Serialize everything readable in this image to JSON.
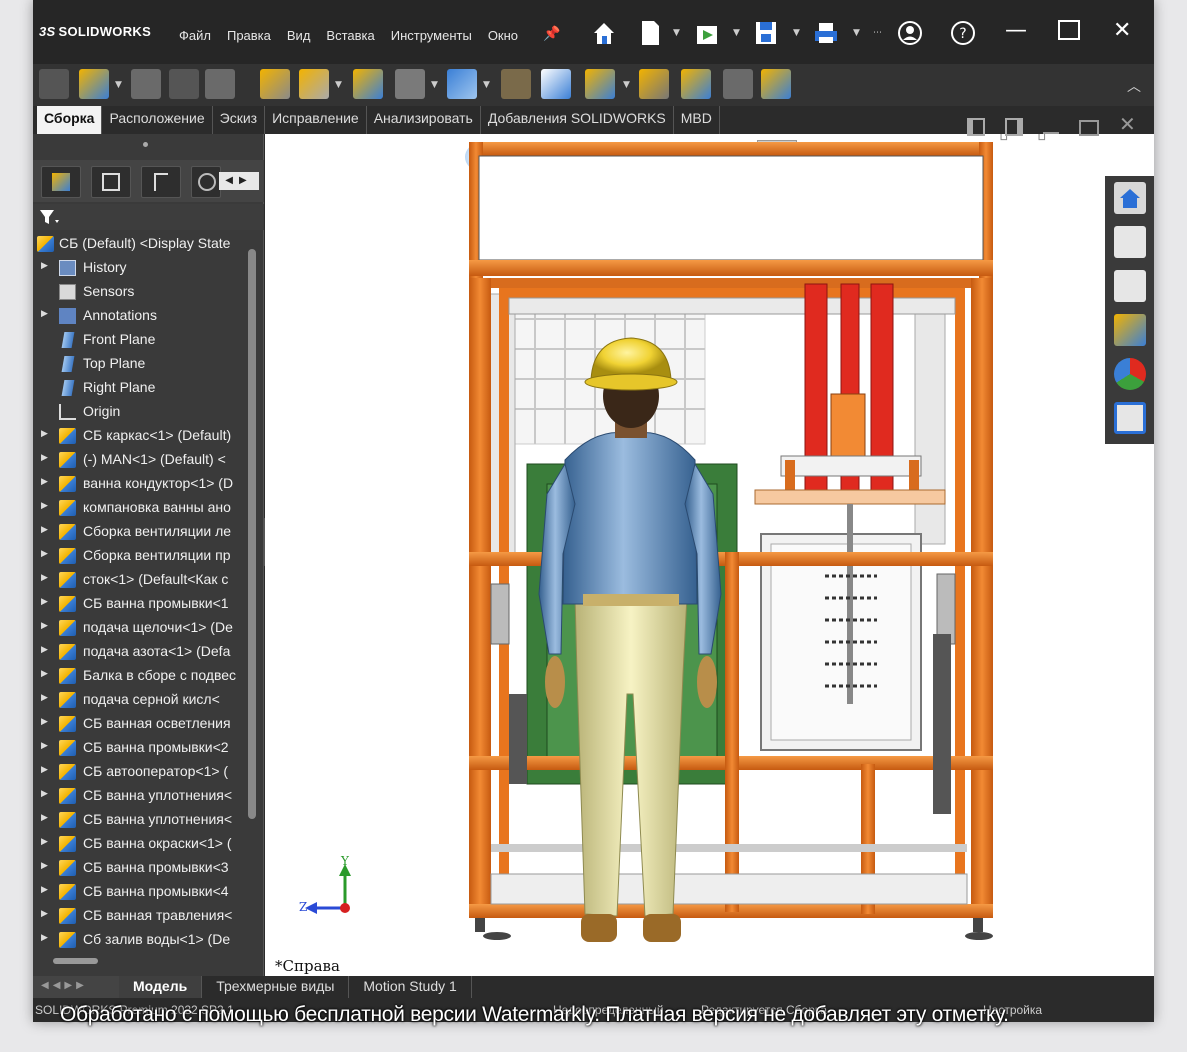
{
  "app": {
    "brand": "SOLIDWORKS",
    "brand_prefix": "3S",
    "menus": [
      "Файл",
      "Правка",
      "Вид",
      "Вставка",
      "Инструменты",
      "Окно"
    ]
  },
  "command_tabs": [
    "Сборка",
    "Расположение",
    "Эскиз",
    "Исправление",
    "Анализировать",
    "Добавления SOLIDWORKS",
    "MBD"
  ],
  "tree": {
    "root": "СБ (Default) <Display State",
    "items": [
      {
        "label": "History",
        "icon": "history",
        "expand": true
      },
      {
        "label": "Sensors",
        "icon": "sensors",
        "expand": false
      },
      {
        "label": "Annotations",
        "icon": "annotations",
        "expand": true
      },
      {
        "label": "Front Plane",
        "icon": "plane",
        "expand": false
      },
      {
        "label": "Top Plane",
        "icon": "plane",
        "expand": false
      },
      {
        "label": "Right Plane",
        "icon": "plane",
        "expand": false
      },
      {
        "label": "Origin",
        "icon": "origin",
        "expand": false
      },
      {
        "label": "СБ каркас<1> (Default)",
        "icon": "assembly",
        "expand": true
      },
      {
        "label": "(-) MAN<1> (Default) <",
        "icon": "assembly",
        "expand": true
      },
      {
        "label": "ванна кондуктор<1> (D",
        "icon": "assembly",
        "expand": true
      },
      {
        "label": "компановка ванны ано",
        "icon": "assembly",
        "expand": true
      },
      {
        "label": "Сборка вентиляции ле",
        "icon": "assembly",
        "expand": true
      },
      {
        "label": "Сборка вентиляции пр",
        "icon": "assembly",
        "expand": true
      },
      {
        "label": "сток<1> (Default<Как с",
        "icon": "assembly",
        "expand": true
      },
      {
        "label": "СБ ванна промывки<1",
        "icon": "assembly",
        "expand": true
      },
      {
        "label": "подача щелочи<1> (De",
        "icon": "assembly",
        "expand": true
      },
      {
        "label": "подача азота<1> (Defa",
        "icon": "assembly",
        "expand": true
      },
      {
        "label": "Балка в сборе с подвес",
        "icon": "assembly",
        "expand": true
      },
      {
        "label": "подача серной кисл<",
        "icon": "assembly",
        "expand": true
      },
      {
        "label": "СБ ванная осветления",
        "icon": "assembly",
        "expand": true
      },
      {
        "label": "СБ ванна промывки<2",
        "icon": "assembly",
        "expand": true
      },
      {
        "label": "СБ автооператор<1> (",
        "icon": "assembly",
        "expand": true
      },
      {
        "label": "СБ ванна уплотнения<",
        "icon": "assembly",
        "expand": true
      },
      {
        "label": "СБ ванна уплотнения<",
        "icon": "assembly",
        "expand": true
      },
      {
        "label": "СБ ванна окраски<1> (",
        "icon": "assembly",
        "expand": true
      },
      {
        "label": "СБ ванна промывки<3",
        "icon": "assembly",
        "expand": true
      },
      {
        "label": "СБ ванна промывки<4",
        "icon": "assembly",
        "expand": true
      },
      {
        "label": "СБ ванная травления<",
        "icon": "assembly",
        "expand": true
      },
      {
        "label": "Сб залив воды<1> (De",
        "icon": "assembly",
        "expand": true
      }
    ]
  },
  "viewport": {
    "view_label": "*Справа",
    "triad": {
      "y": "Y",
      "z": "Z"
    }
  },
  "bottom_tabs": [
    "Модель",
    "Трехмерные виды",
    "Motion Study 1"
  ],
  "status": {
    "left": "SOLIDWORKS Premium 2022 SP2.1",
    "middle": "Недоопределенный",
    "right": "Редактируется Сборка",
    "custom": "Настройка"
  },
  "watermark": "Обработано с помощью бесплатной версии Watermarkly. Платная версия не добавляет эту отметку.",
  "colors": {
    "frame_orange": "#e8751e",
    "vertical_red": "#e02a1f",
    "helmet_yellow": "#f0d233",
    "shirt_blue": "#5d88b8",
    "pants_yellow": "#e8e3a1"
  }
}
